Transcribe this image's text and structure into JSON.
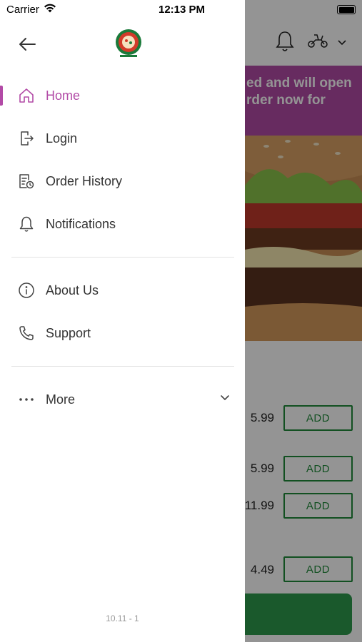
{
  "status_bar": {
    "carrier": "Carrier",
    "time": "12:13 PM"
  },
  "drawer": {
    "menu_primary": [
      {
        "id": "home",
        "label": "Home",
        "icon": "home-icon",
        "active": true
      },
      {
        "id": "login",
        "label": "Login",
        "icon": "login-icon"
      },
      {
        "id": "order-history",
        "label": "Order History",
        "icon": "order-history-icon"
      },
      {
        "id": "notifications",
        "label": "Notifications",
        "icon": "bell-icon"
      }
    ],
    "menu_secondary": [
      {
        "id": "about-us",
        "label": "About Us",
        "icon": "info-icon"
      },
      {
        "id": "support",
        "label": "Support",
        "icon": "phone-icon"
      }
    ],
    "more": {
      "label": "More",
      "icon": "more-dots-icon"
    },
    "version": "10.11 - 1"
  },
  "background_app": {
    "banner_line_1": "ed and will open",
    "banner_line_2": "rder now for",
    "items": [
      {
        "price": "5.99",
        "add_label": "ADD"
      },
      {
        "price": "5.99",
        "add_label": "ADD"
      },
      {
        "price": "11.99",
        "add_label": "ADD"
      },
      {
        "price": "4.49",
        "add_label": "ADD"
      }
    ]
  },
  "colors": {
    "accent": "#b24aa6",
    "add_green": "#1f8a3a",
    "banner": "#b14aa6"
  }
}
